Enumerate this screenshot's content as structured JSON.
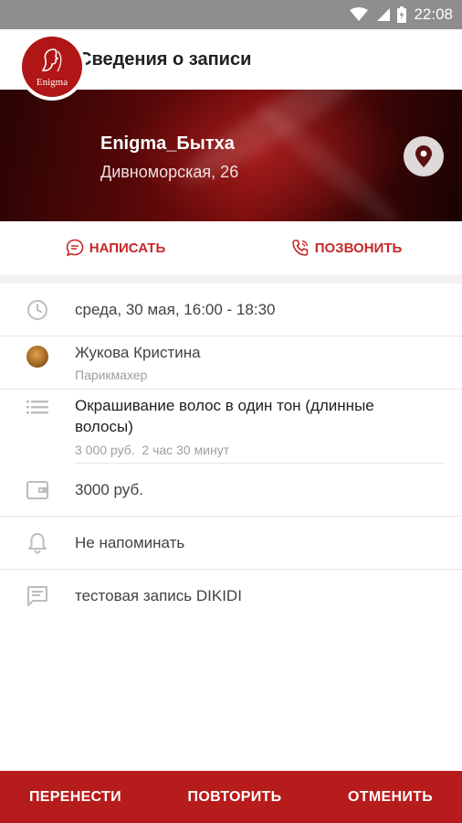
{
  "status_bar": {
    "time": "22:08"
  },
  "app_bar": {
    "title": "Сведения о записи"
  },
  "salon": {
    "name": "Enigma_Бытха",
    "address": "Дивноморская, 26",
    "logo_text": "Enigma"
  },
  "actions": {
    "write_label": "НАПИСАТЬ",
    "call_label": "ПОЗВОНИТЬ"
  },
  "appointment": {
    "datetime": "среда, 30 мая, 16:00 - 18:30",
    "master_name": "Жукова Кристина",
    "master_role": "Парикмахер",
    "service_name_line1": "Окрашивание волос в один тон (длинные",
    "service_name_line2": "волосы)",
    "service_price": "3 000 руб.",
    "service_duration": "2 час 30 минут",
    "total": "3000 руб.",
    "reminder": "Не напоминать",
    "comment": "тестовая запись DIKIDI"
  },
  "bottom_actions": {
    "reschedule": "ПЕРЕНЕСТИ",
    "repeat": "ПОВТОРИТЬ",
    "cancel": "ОТМЕНИТЬ"
  },
  "colors": {
    "accent": "#c62828",
    "bottom_bar": "#b71c1c",
    "status_bar": "#8e8e8e"
  },
  "icons": [
    "wifi-icon",
    "signal-icon",
    "battery-icon",
    "back-arrow-icon",
    "map-pin-icon",
    "chat-icon",
    "phone-icon",
    "clock-icon",
    "list-icon",
    "wallet-icon",
    "bell-icon",
    "comment-icon"
  ]
}
